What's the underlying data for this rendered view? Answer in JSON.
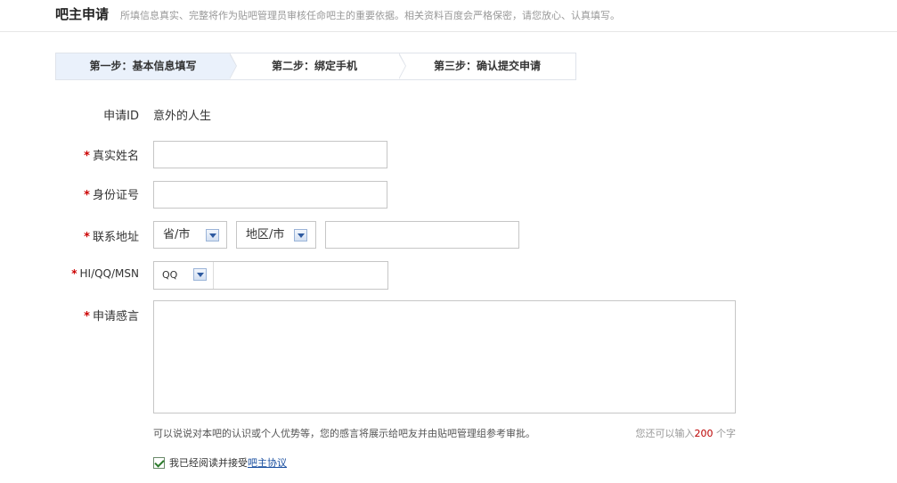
{
  "header": {
    "title": "吧主申请",
    "description": "所填信息真实、完整将作为贴吧管理员审核任命吧主的重要依据。相关资料百度会严格保密，请您放心、认真填写。"
  },
  "steps": [
    {
      "label": "第一步：基本信息填写",
      "active": true
    },
    {
      "label": "第二步：绑定手机",
      "active": false
    },
    {
      "label": "第三步：确认提交申请",
      "active": false
    }
  ],
  "form": {
    "required_mark": "*",
    "applicant_id": {
      "label": "申请ID",
      "value": "意外的人生"
    },
    "real_name": {
      "label": "真实姓名",
      "value": ""
    },
    "id_number": {
      "label": "身份证号",
      "value": ""
    },
    "address": {
      "label": "联系地址",
      "province": "省/市",
      "district": "地区/市",
      "detail_value": ""
    },
    "im": {
      "label": "HI/QQ/MSN",
      "type": "QQ",
      "value": ""
    },
    "statement": {
      "label": "申请感言",
      "value": "",
      "hint": "可以说说对本吧的认识或个人优势等，您的感言将展示给吧友并由贴吧管理组参考审批。",
      "counter_prefix": "您还可以输入",
      "counter_value": "200",
      "counter_suffix": " 个字"
    },
    "agreement": {
      "checked": true,
      "text": "我已经阅读并接受",
      "link": "吧主协议"
    }
  }
}
